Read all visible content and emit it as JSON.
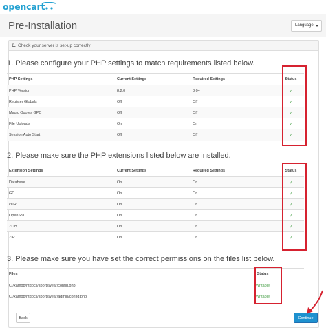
{
  "brand": {
    "logo_text": "opencart",
    "accent": "#23a1d1"
  },
  "header": {
    "title": "Pre-Installation",
    "language_button": "Language"
  },
  "panel": {
    "heading": "Check your server is set-up correctly"
  },
  "section1": {
    "title": "1. Please configure your PHP settings to match requirements listed below.",
    "columns": [
      "PHP Settings",
      "Current Settings",
      "Required Settings",
      "Status"
    ],
    "rows": [
      {
        "name": "PHP Version",
        "current": "8.2.0",
        "required": "8.0+",
        "status": "✓"
      },
      {
        "name": "Register Globals",
        "current": "Off",
        "required": "Off",
        "status": "✓"
      },
      {
        "name": "Magic Quotes GPC",
        "current": "Off",
        "required": "Off",
        "status": "✓"
      },
      {
        "name": "File Uploads",
        "current": "On",
        "required": "On",
        "status": "✓"
      },
      {
        "name": "Session Auto Start",
        "current": "Off",
        "required": "Off",
        "status": "✓"
      }
    ]
  },
  "section2": {
    "title": "2. Please make sure the PHP extensions listed below are installed.",
    "columns": [
      "Extension Settings",
      "Current Settings",
      "Required Settings",
      "Status"
    ],
    "rows": [
      {
        "name": "Database",
        "current": "On",
        "required": "On",
        "status": "✓"
      },
      {
        "name": "GD",
        "current": "On",
        "required": "On",
        "status": "✓"
      },
      {
        "name": "cURL",
        "current": "On",
        "required": "On",
        "status": "✓"
      },
      {
        "name": "OpenSSL",
        "current": "On",
        "required": "On",
        "status": "✓"
      },
      {
        "name": "ZLIB",
        "current": "On",
        "required": "On",
        "status": "✓"
      },
      {
        "name": "ZIP",
        "current": "On",
        "required": "On",
        "status": "✓"
      }
    ]
  },
  "section3": {
    "title": "3. Please make sure you have set the correct permissions on the files list below.",
    "columns": [
      "Files",
      "Status"
    ],
    "rows": [
      {
        "file": "C:/xampp/htdocs/sportswear/config.php",
        "status": "Writable"
      },
      {
        "file": "C:/xampp/htdocs/sportswear/admin/config.php",
        "status": "Writable"
      }
    ]
  },
  "buttons": {
    "back": "Back",
    "continue": "Continue"
  },
  "colors": {
    "ok": "#3c9a3c",
    "highlight": "#d62230",
    "primary": "#1e91cf"
  }
}
